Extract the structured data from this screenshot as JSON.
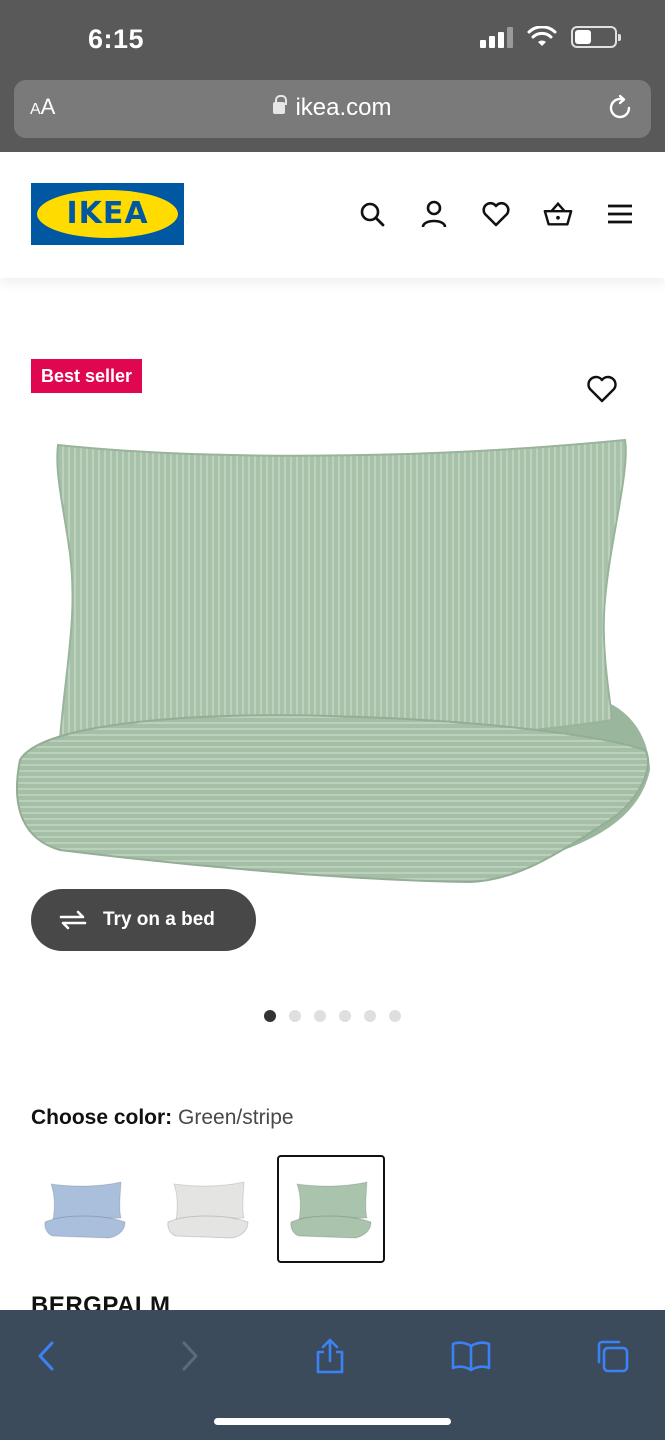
{
  "status_bar": {
    "time": "6:15"
  },
  "browser": {
    "text_size_button": "AA",
    "url": "ikea.com"
  },
  "header": {
    "logo_text": "IKEA",
    "icons": [
      "search-icon",
      "account-icon",
      "heart-icon",
      "basket-icon",
      "menu-icon"
    ]
  },
  "product": {
    "badge": "Best seller",
    "try_button_label": "Try on a bed",
    "image_count": 6,
    "active_image_index": 0,
    "choose_color_label": "Choose color:",
    "selected_color": "Green/stripe",
    "color_options": [
      {
        "color": "#a9bfdc"
      },
      {
        "color": "#e4e4e2"
      },
      {
        "color": "#a9c3ac"
      }
    ],
    "selected_option_index": 2,
    "name": "BERGPALM"
  },
  "colors": {
    "brand_blue": "#0058a3",
    "brand_yellow": "#ffdb00",
    "badge_red": "#e00751",
    "safari_blue": "#3b82f6"
  }
}
